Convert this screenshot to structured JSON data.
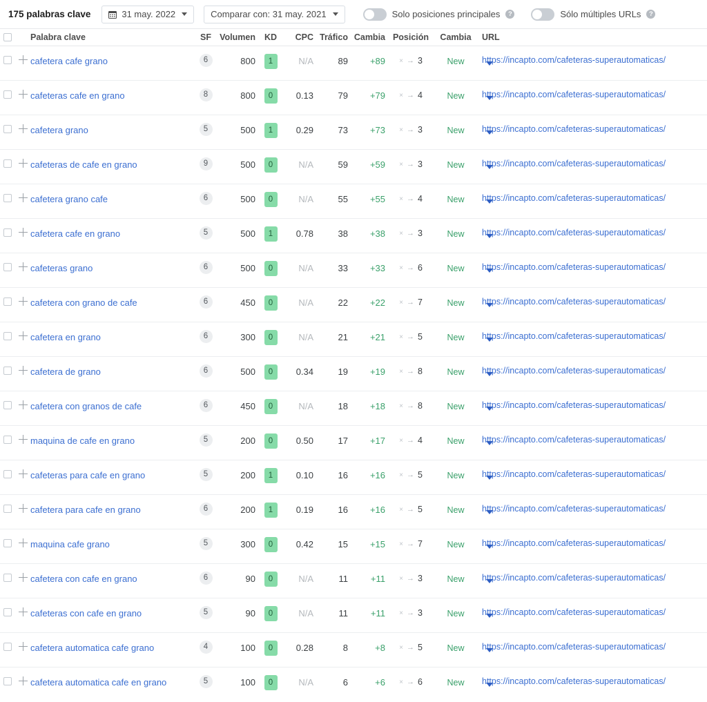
{
  "toolbar": {
    "keyword_count_label": "175 palabras clave",
    "date_picker": {
      "icon": "calendar-icon",
      "value": "31 may. 2022",
      "caret": "chevron-down-icon"
    },
    "compare_picker": {
      "value": "Comparar con: 31 may. 2021",
      "caret": "chevron-down-icon"
    },
    "toggles": [
      {
        "label": "Solo posiciones principales",
        "on": false,
        "help": "help-icon"
      },
      {
        "label": "Sólo múltiples URLs",
        "on": false,
        "help": "help-icon"
      }
    ]
  },
  "table": {
    "columns": [
      {
        "key": "keyword",
        "label": "Palabra clave"
      },
      {
        "key": "sf",
        "label": "SF"
      },
      {
        "key": "volume",
        "label": "Volumen"
      },
      {
        "key": "kd",
        "label": "KD"
      },
      {
        "key": "cpc",
        "label": "CPC"
      },
      {
        "key": "traffic",
        "label": "Tráfico"
      },
      {
        "key": "traffic_change",
        "label": "Cambia"
      },
      {
        "key": "position",
        "label": "Posición"
      },
      {
        "key": "position_change",
        "label": "Cambia"
      },
      {
        "key": "url",
        "label": "URL"
      }
    ],
    "position_from_symbol": "×",
    "position_arrow": "→",
    "rows": [
      {
        "keyword": "cafetera cafe grano",
        "sf": "6",
        "volume": "800",
        "kd": "1",
        "cpc": "N/A",
        "cpc_na": true,
        "traffic": "89",
        "traffic_change": "+89",
        "pos_from": "×",
        "pos_to": "3",
        "position_change": "New",
        "url": "https://incapto.com/cafeteras-superautomaticas/"
      },
      {
        "keyword": "cafeteras cafe en grano",
        "sf": "8",
        "volume": "800",
        "kd": "0",
        "cpc": "0.13",
        "cpc_na": false,
        "traffic": "79",
        "traffic_change": "+79",
        "pos_from": "×",
        "pos_to": "4",
        "position_change": "New",
        "url": "https://incapto.com/cafeteras-superautomaticas/"
      },
      {
        "keyword": "cafetera grano",
        "sf": "5",
        "volume": "500",
        "kd": "1",
        "cpc": "0.29",
        "cpc_na": false,
        "traffic": "73",
        "traffic_change": "+73",
        "pos_from": "×",
        "pos_to": "3",
        "position_change": "New",
        "url": "https://incapto.com/cafeteras-superautomaticas/"
      },
      {
        "keyword": "cafeteras de cafe en grano",
        "sf": "9",
        "volume": "500",
        "kd": "0",
        "cpc": "N/A",
        "cpc_na": true,
        "traffic": "59",
        "traffic_change": "+59",
        "pos_from": "×",
        "pos_to": "3",
        "position_change": "New",
        "url": "https://incapto.com/cafeteras-superautomaticas/"
      },
      {
        "keyword": "cafetera grano cafe",
        "sf": "6",
        "volume": "500",
        "kd": "0",
        "cpc": "N/A",
        "cpc_na": true,
        "traffic": "55",
        "traffic_change": "+55",
        "pos_from": "×",
        "pos_to": "4",
        "position_change": "New",
        "url": "https://incapto.com/cafeteras-superautomaticas/"
      },
      {
        "keyword": "cafetera cafe en grano",
        "sf": "5",
        "volume": "500",
        "kd": "1",
        "cpc": "0.78",
        "cpc_na": false,
        "traffic": "38",
        "traffic_change": "+38",
        "pos_from": "×",
        "pos_to": "3",
        "position_change": "New",
        "url": "https://incapto.com/cafeteras-superautomaticas/"
      },
      {
        "keyword": "cafeteras grano",
        "sf": "6",
        "volume": "500",
        "kd": "0",
        "cpc": "N/A",
        "cpc_na": true,
        "traffic": "33",
        "traffic_change": "+33",
        "pos_from": "×",
        "pos_to": "6",
        "position_change": "New",
        "url": "https://incapto.com/cafeteras-superautomaticas/"
      },
      {
        "keyword": "cafetera con grano de cafe",
        "sf": "6",
        "volume": "450",
        "kd": "0",
        "cpc": "N/A",
        "cpc_na": true,
        "traffic": "22",
        "traffic_change": "+22",
        "pos_from": "×",
        "pos_to": "7",
        "position_change": "New",
        "url": "https://incapto.com/cafeteras-superautomaticas/"
      },
      {
        "keyword": "cafetera en grano",
        "sf": "6",
        "volume": "300",
        "kd": "0",
        "cpc": "N/A",
        "cpc_na": true,
        "traffic": "21",
        "traffic_change": "+21",
        "pos_from": "×",
        "pos_to": "5",
        "position_change": "New",
        "url": "https://incapto.com/cafeteras-superautomaticas/"
      },
      {
        "keyword": "cafetera de grano",
        "sf": "6",
        "volume": "500",
        "kd": "0",
        "cpc": "0.34",
        "cpc_na": false,
        "traffic": "19",
        "traffic_change": "+19",
        "pos_from": "×",
        "pos_to": "8",
        "position_change": "New",
        "url": "https://incapto.com/cafeteras-superautomaticas/"
      },
      {
        "keyword": "cafetera con granos de cafe",
        "sf": "6",
        "volume": "450",
        "kd": "0",
        "cpc": "N/A",
        "cpc_na": true,
        "traffic": "18",
        "traffic_change": "+18",
        "pos_from": "×",
        "pos_to": "8",
        "position_change": "New",
        "url": "https://incapto.com/cafeteras-superautomaticas/"
      },
      {
        "keyword": "maquina de cafe en grano",
        "sf": "5",
        "volume": "200",
        "kd": "0",
        "cpc": "0.50",
        "cpc_na": false,
        "traffic": "17",
        "traffic_change": "+17",
        "pos_from": "×",
        "pos_to": "4",
        "position_change": "New",
        "url": "https://incapto.com/cafeteras-superautomaticas/"
      },
      {
        "keyword": "cafeteras para cafe en grano",
        "sf": "5",
        "volume": "200",
        "kd": "1",
        "cpc": "0.10",
        "cpc_na": false,
        "traffic": "16",
        "traffic_change": "+16",
        "pos_from": "×",
        "pos_to": "5",
        "position_change": "New",
        "url": "https://incapto.com/cafeteras-superautomaticas/"
      },
      {
        "keyword": "cafetera para cafe en grano",
        "sf": "6",
        "volume": "200",
        "kd": "1",
        "cpc": "0.19",
        "cpc_na": false,
        "traffic": "16",
        "traffic_change": "+16",
        "pos_from": "×",
        "pos_to": "5",
        "position_change": "New",
        "url": "https://incapto.com/cafeteras-superautomaticas/"
      },
      {
        "keyword": "maquina cafe grano",
        "sf": "5",
        "volume": "300",
        "kd": "0",
        "cpc": "0.42",
        "cpc_na": false,
        "traffic": "15",
        "traffic_change": "+15",
        "pos_from": "×",
        "pos_to": "7",
        "position_change": "New",
        "url": "https://incapto.com/cafeteras-superautomaticas/"
      },
      {
        "keyword": "cafetera con cafe en grano",
        "sf": "6",
        "volume": "90",
        "kd": "0",
        "cpc": "N/A",
        "cpc_na": true,
        "traffic": "11",
        "traffic_change": "+11",
        "pos_from": "×",
        "pos_to": "3",
        "position_change": "New",
        "url": "https://incapto.com/cafeteras-superautomaticas/"
      },
      {
        "keyword": "cafeteras con cafe en grano",
        "sf": "5",
        "volume": "90",
        "kd": "0",
        "cpc": "N/A",
        "cpc_na": true,
        "traffic": "11",
        "traffic_change": "+11",
        "pos_from": "×",
        "pos_to": "3",
        "position_change": "New",
        "url": "https://incapto.com/cafeteras-superautomaticas/"
      },
      {
        "keyword": "cafetera automatica cafe grano",
        "sf": "4",
        "volume": "100",
        "kd": "0",
        "cpc": "0.28",
        "cpc_na": false,
        "traffic": "8",
        "traffic_change": "+8",
        "pos_from": "×",
        "pos_to": "5",
        "position_change": "New",
        "url": "https://incapto.com/cafeteras-superautomaticas/"
      },
      {
        "keyword": "cafetera automatica cafe en grano",
        "sf": "5",
        "volume": "100",
        "kd": "0",
        "cpc": "N/A",
        "cpc_na": true,
        "traffic": "6",
        "traffic_change": "+6",
        "pos_from": "×",
        "pos_to": "6",
        "position_change": "New",
        "url": "https://incapto.com/cafeteras-superautomaticas/"
      }
    ]
  },
  "colors": {
    "link": "#3c6fd1",
    "positive": "#3aa06a",
    "kd_badge_bg": "#86dba8",
    "sf_badge_bg": "#eceef0",
    "border": "#eceef0"
  }
}
